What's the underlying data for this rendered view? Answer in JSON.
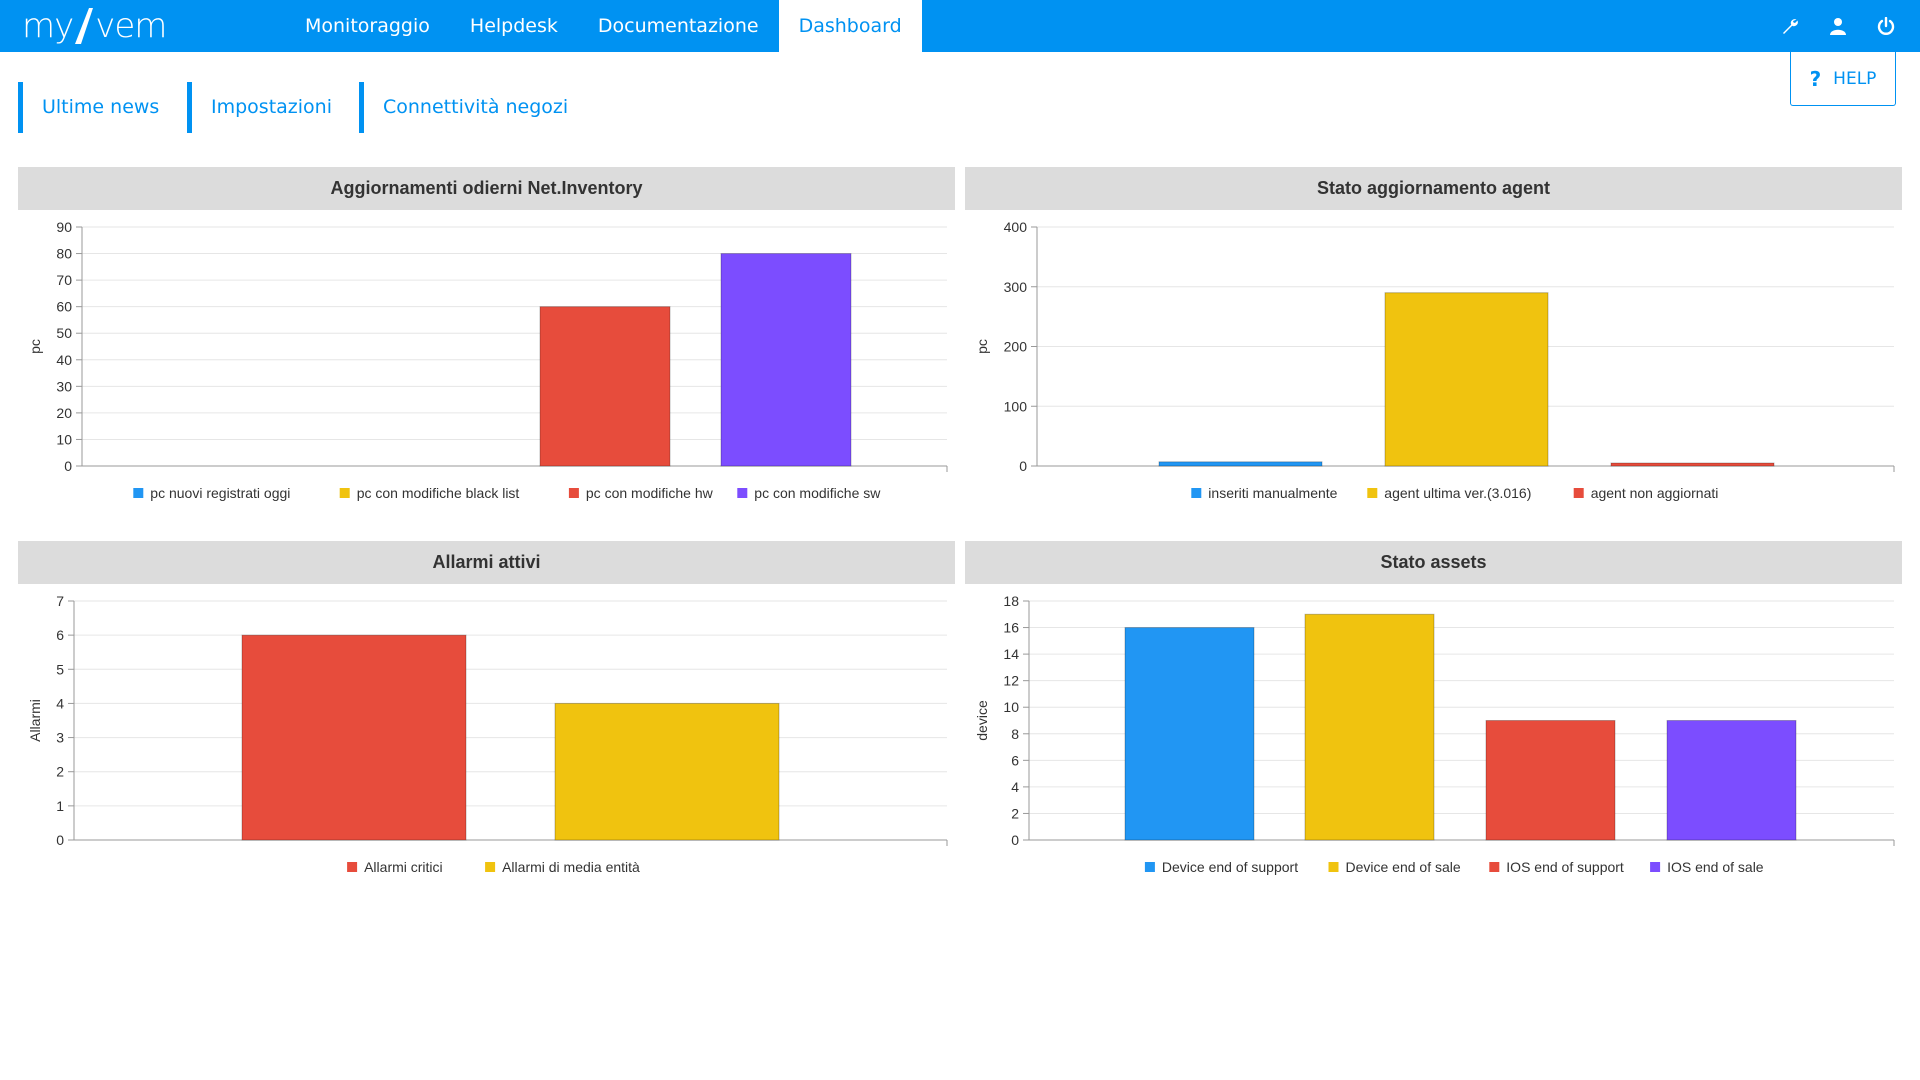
{
  "app": {
    "logo_left": "my",
    "logo_right": "vem",
    "nav": [
      {
        "label": "Monitoraggio",
        "active": false
      },
      {
        "label": "Helpdesk",
        "active": false
      },
      {
        "label": "Documentazione",
        "active": false
      },
      {
        "label": "Dashboard",
        "active": true
      }
    ],
    "icons": [
      "wrench-icon",
      "user-icon",
      "power-icon"
    ],
    "sublinks": [
      "Ultime news",
      "Impostazioni",
      "Connettività negozi"
    ],
    "help_label": "HELP"
  },
  "colors": {
    "brand": "#0092f2",
    "blue": "#2196f3",
    "yellow": "#f0c30f",
    "red": "#e74c3c",
    "purple": "#7c4dff"
  },
  "chart_data": [
    {
      "type": "bar",
      "title": "Aggiornamenti odierni Net.Inventory",
      "ylabel": "pc",
      "ylim": [
        0,
        90
      ],
      "yticks": [
        0,
        10,
        20,
        30,
        40,
        50,
        60,
        70,
        80,
        90
      ],
      "grid": true,
      "legend": "bottom",
      "series": [
        {
          "name": "pc nuovi registrati oggi",
          "value": 0,
          "color": "#2196f3"
        },
        {
          "name": "pc con modifiche black list",
          "value": 0,
          "color": "#f0c30f"
        },
        {
          "name": "pc con modifiche hw",
          "value": 60,
          "color": "#e74c3c"
        },
        {
          "name": "pc con modifiche sw",
          "value": 80,
          "color": "#7c4dff"
        }
      ]
    },
    {
      "type": "bar",
      "title": "Stato aggiornamento agent",
      "ylabel": "pc",
      "ylim": [
        0,
        400
      ],
      "yticks": [
        0,
        100,
        200,
        300,
        400
      ],
      "grid": true,
      "legend": "bottom",
      "series": [
        {
          "name": "inseriti manualmente",
          "value": 7,
          "color": "#2196f3"
        },
        {
          "name": "agent ultima ver.(3.016)",
          "value": 290,
          "color": "#f0c30f"
        },
        {
          "name": "agent non aggiornati",
          "value": 2,
          "color": "#e74c3c"
        }
      ]
    },
    {
      "type": "bar",
      "title": "Allarmi attivi",
      "ylabel": "Allarmi",
      "ylim": [
        0,
        7
      ],
      "yticks": [
        0,
        1,
        2,
        3,
        4,
        5,
        6,
        7
      ],
      "grid": true,
      "legend": "bottom",
      "series": [
        {
          "name": "Allarmi critici",
          "value": 6,
          "color": "#e74c3c"
        },
        {
          "name": "Allarmi di media entità",
          "value": 4,
          "color": "#f0c30f"
        }
      ]
    },
    {
      "type": "bar",
      "title": "Stato assets",
      "ylabel": "device",
      "ylim": [
        0,
        18
      ],
      "yticks": [
        0,
        2,
        4,
        6,
        8,
        10,
        12,
        14,
        16,
        18
      ],
      "grid": true,
      "legend": "bottom",
      "series": [
        {
          "name": "Device end of support",
          "value": 16,
          "color": "#2196f3"
        },
        {
          "name": "Device end of sale",
          "value": 17,
          "color": "#f0c30f"
        },
        {
          "name": "IOS end of support",
          "value": 9,
          "color": "#e74c3c"
        },
        {
          "name": "IOS end of sale",
          "value": 9,
          "color": "#7c4dff"
        }
      ]
    }
  ]
}
